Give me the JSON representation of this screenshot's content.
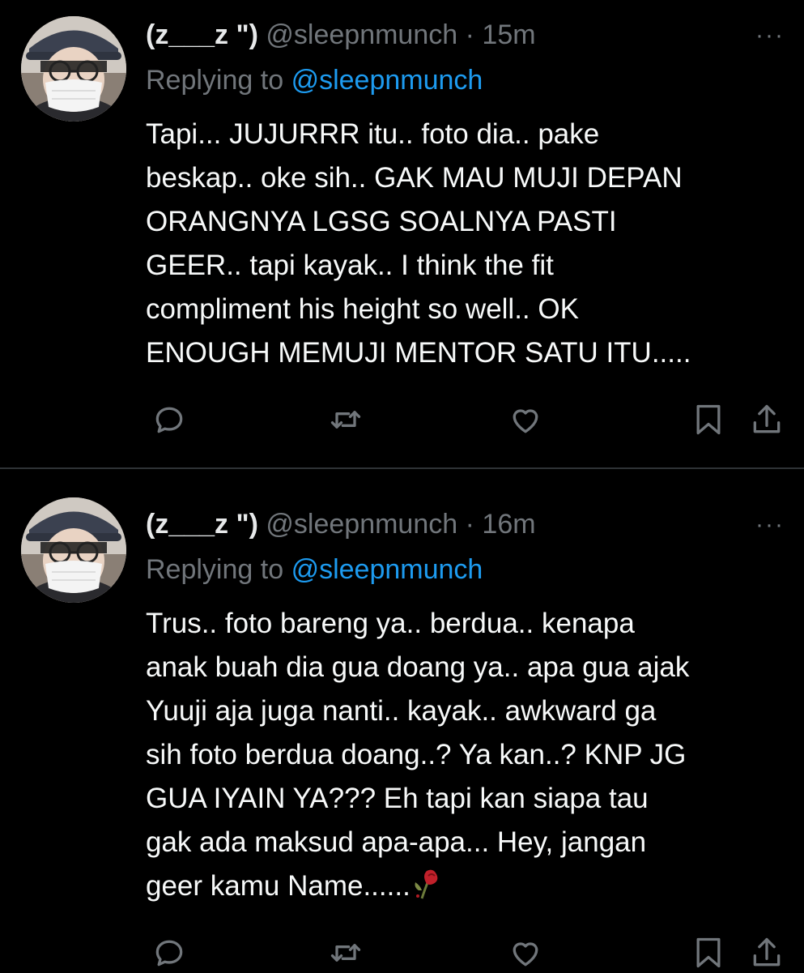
{
  "tweets": [
    {
      "display_name": "(z___z \")",
      "handle": "@sleepnmunch",
      "separator": "·",
      "time": "15m",
      "more": "···",
      "replying_prefix": "Replying to",
      "replying_handle": "@sleepnmunch",
      "text": "Tapi... JUJURRR itu.. foto dia.. pake\nbeskap.. oke sih.. GAK MAU MUJI DEPAN\nORANGNYA LGSG SOALNYA PASTI\nGEER.. tapi kayak.. I think the fit\ncompliment his height so well.. OK\nENOUGH MEMUJI MENTOR SATU ITU....."
    },
    {
      "display_name": "(z___z \")",
      "handle": "@sleepnmunch",
      "separator": "·",
      "time": "16m",
      "more": "···",
      "replying_prefix": "Replying to",
      "replying_handle": "@sleepnmunch",
      "text": "Trus.. foto bareng ya.. berdua.. kenapa\nanak buah dia gua doang ya.. apa gua ajak\nYuuji aja juga nanti.. kayak.. awkward ga\nsih foto berdua doang..? Ya kan..? KNP JG\nGUA IYAIN YA??? Eh tapi kan siapa tau\ngak ada maksud apa-apa... Hey, jangan\ngeer kamu Name......",
      "trailing_emoji": "wilted-rose-emoji"
    }
  ],
  "icons": [
    "reply-icon",
    "retweet-icon",
    "like-icon",
    "bookmark-icon",
    "share-icon"
  ],
  "colors": {
    "background": "#000000",
    "text": "#e7e9ea",
    "muted": "#71767b",
    "link": "#1d9bf0",
    "divider": "#2f3336"
  }
}
